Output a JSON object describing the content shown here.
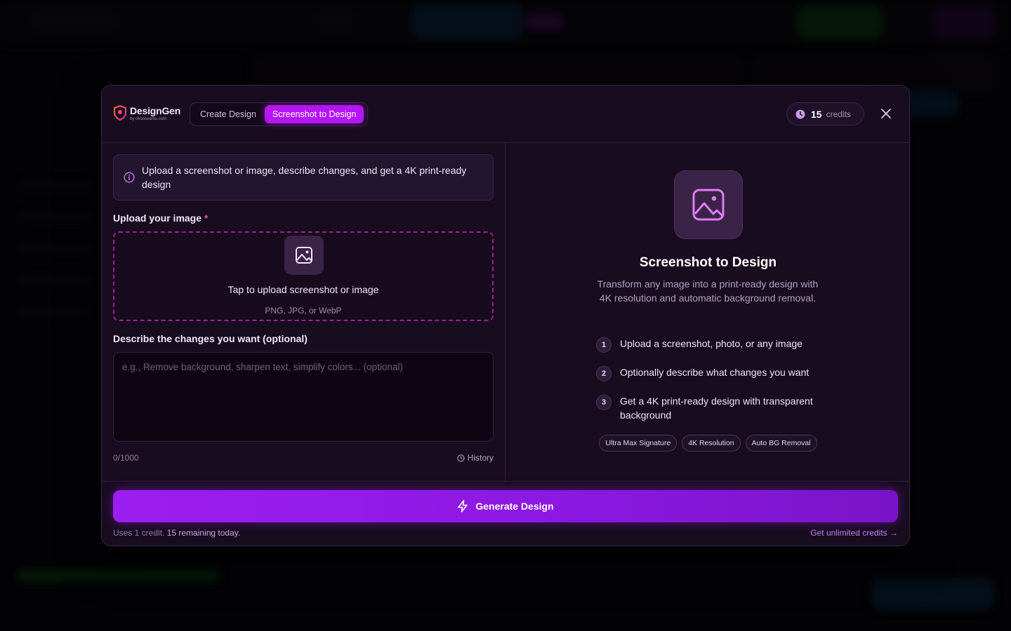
{
  "header": {
    "logo_name": "DesignGen",
    "logo_sub": "by chooseamu.com",
    "tabs": [
      {
        "label": "Create Design",
        "active": false
      },
      {
        "label": "Screenshot to Design",
        "active": true
      }
    ],
    "credits_count": "15",
    "credits_label": "credits"
  },
  "left": {
    "info_text": "Upload a screenshot or image, describe changes, and get a 4K print-ready design",
    "upload_label": "Upload your image",
    "required_mark": "*",
    "dropzone_title": "Tap to upload screenshot or image",
    "dropzone_formats": "PNG, JPG, or WebP",
    "describe_label": "Describe the changes you want (optional)",
    "describe_placeholder": "e.g., Remove background, sharpen text, simplify colors... (optional)",
    "char_counter": "0/1000",
    "history_label": "History"
  },
  "right": {
    "title": "Screenshot to Design",
    "description": "Transform any image into a print-ready design with 4K resolution and automatic background removal.",
    "steps": [
      {
        "num": "1",
        "text": "Upload a screenshot, photo, or any image"
      },
      {
        "num": "2",
        "text": "Optionally describe what changes you want"
      },
      {
        "num": "3",
        "text": "Get a 4K print-ready design with transparent background"
      }
    ],
    "badges": [
      "Ultra Max Signature",
      "4K Resolution",
      "Auto BG Removal"
    ]
  },
  "footer": {
    "generate_label": "Generate Design",
    "note_prefix": "Uses 1 credit.",
    "note_highlight": "15 remaining today.",
    "unlimited_link": "Get unlimited credits →"
  },
  "colors": {
    "accent": "#b516f5",
    "modal_bg": "#180c1f",
    "border": "#3a2447"
  }
}
